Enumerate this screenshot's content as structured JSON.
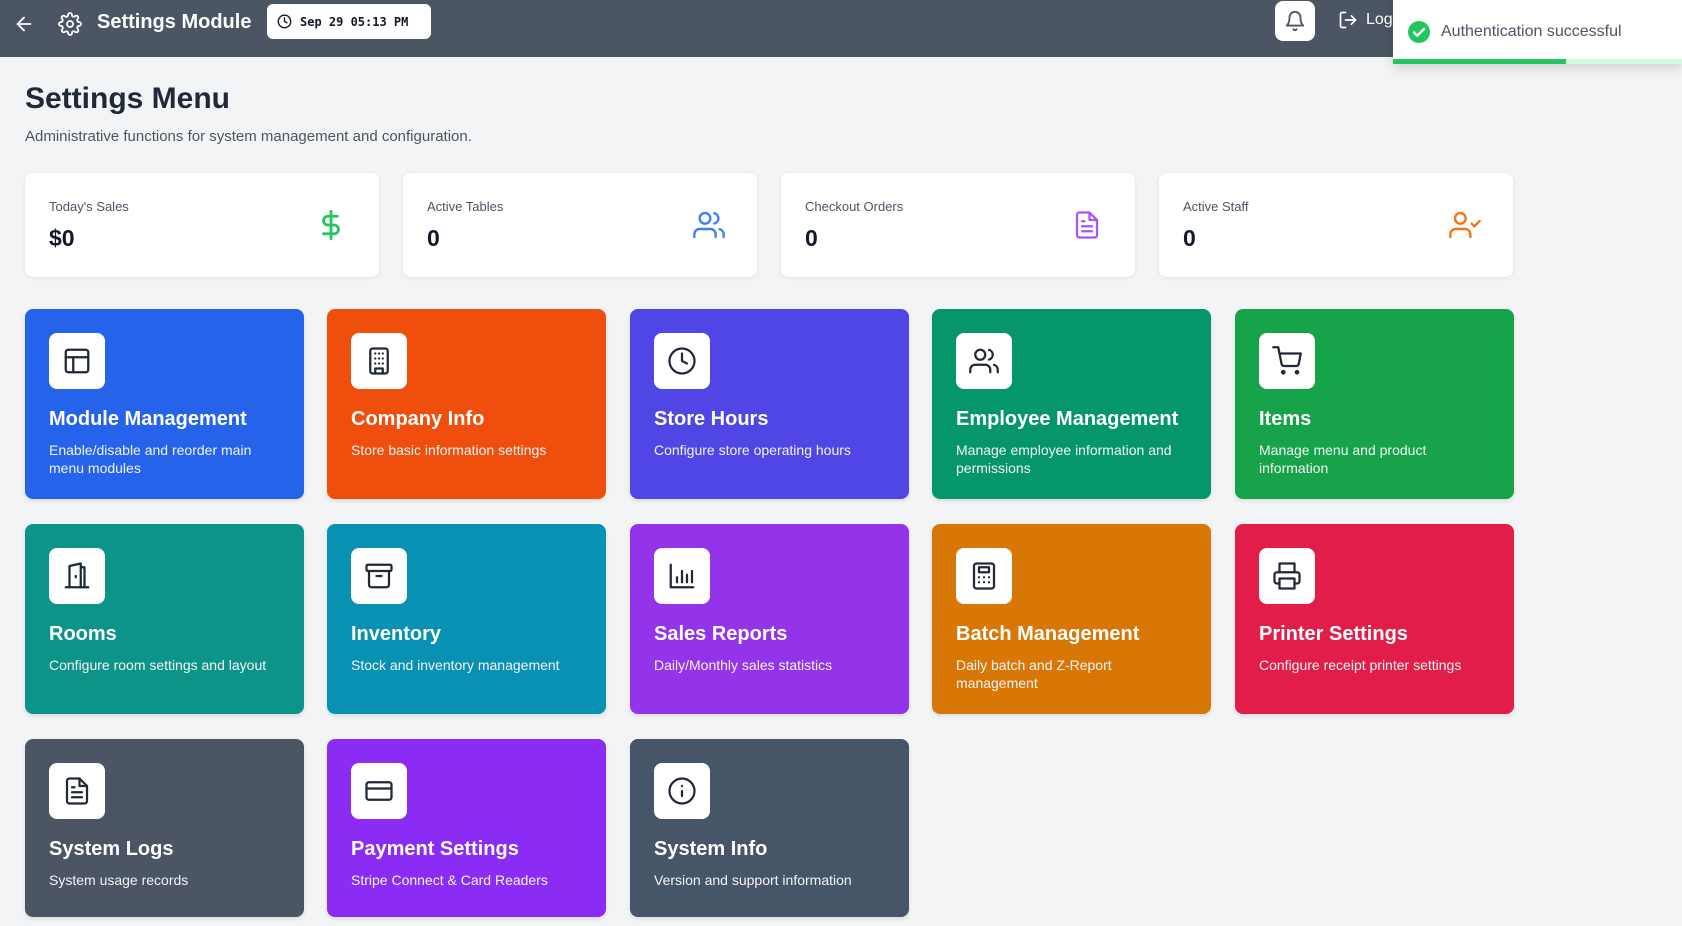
{
  "header": {
    "title": "Settings Module",
    "datetime": "Sep 29 05:13 PM",
    "logout_label": "Log"
  },
  "toast": {
    "message": "Authentication successful",
    "progress": 0.6
  },
  "page": {
    "title": "Settings Menu",
    "subtitle": "Administrative functions for system management and configuration."
  },
  "stats": [
    {
      "label": "Today's Sales",
      "value": "$0",
      "icon": "dollar-icon",
      "color": "#22c55e"
    },
    {
      "label": "Active Tables",
      "value": "0",
      "icon": "users-icon",
      "color": "#3b82f6"
    },
    {
      "label": "Checkout Orders",
      "value": "0",
      "icon": "document-icon",
      "color": "#a855f7"
    },
    {
      "label": "Active Staff",
      "value": "0",
      "icon": "user-check-icon",
      "color": "#f97316"
    }
  ],
  "cards": [
    {
      "title": "Module Management",
      "desc": "Enable/disable and reorder main menu modules",
      "icon": "layout-icon",
      "color": "#2563eb"
    },
    {
      "title": "Company Info",
      "desc": "Store basic information settings",
      "icon": "building-icon",
      "color": "#f04e0c"
    },
    {
      "title": "Store Hours",
      "desc": "Configure store operating hours",
      "icon": "clock-icon",
      "color": "#4f46e5"
    },
    {
      "title": "Employee Management",
      "desc": "Manage employee information and permissions",
      "icon": "users-icon",
      "color": "#059669"
    },
    {
      "title": "Items",
      "desc": "Manage menu and product information",
      "icon": "cart-icon",
      "color": "#16a34a"
    },
    {
      "title": "Rooms",
      "desc": "Configure room settings and layout",
      "icon": "door-icon",
      "color": "#0d9488"
    },
    {
      "title": "Inventory",
      "desc": "Stock and inventory management",
      "icon": "archive-icon",
      "color": "#0891b2"
    },
    {
      "title": "Sales Reports",
      "desc": "Daily/Monthly sales statistics",
      "icon": "bar-chart-icon",
      "color": "#9333ea"
    },
    {
      "title": "Batch Management",
      "desc": "Daily batch and Z-Report management",
      "icon": "calculator-icon",
      "color": "#d97706"
    },
    {
      "title": "Printer Settings",
      "desc": "Configure receipt printer settings",
      "icon": "printer-icon",
      "color": "#e11d48"
    },
    {
      "title": "System Logs",
      "desc": "System usage records",
      "icon": "file-text-icon",
      "color": "#4b5563"
    },
    {
      "title": "Payment Settings",
      "desc": "Stripe Connect & Card Readers",
      "icon": "credit-card-icon",
      "color": "#8b2cf5"
    },
    {
      "title": "System Info",
      "desc": "Version and support information",
      "icon": "info-icon",
      "color": "#475569"
    }
  ]
}
